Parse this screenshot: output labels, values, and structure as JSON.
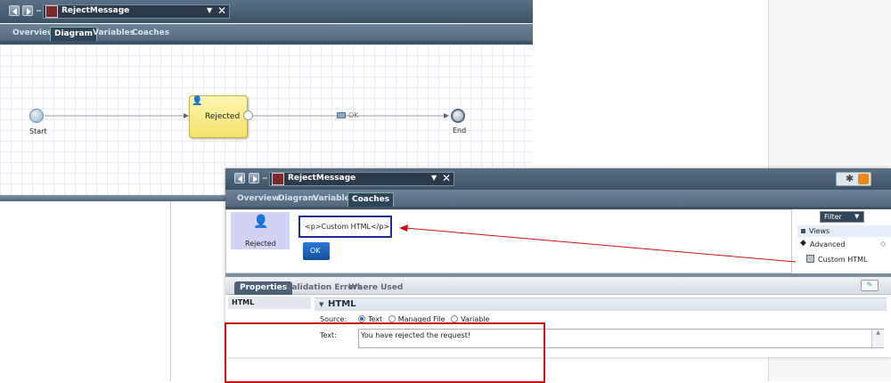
{
  "back_editor": {
    "title": "RejectMessage",
    "tabs": [
      "Overview",
      "Diagram",
      "Variables",
      "Coaches"
    ],
    "diagram": {
      "start_label": "Start",
      "coach_label": "Rejected",
      "flow_label": "OK",
      "end_label": "End"
    }
  },
  "front_editor": {
    "title": "RejectMessage",
    "tabs": [
      "Overview",
      "Diagram",
      "Variables",
      "Coaches"
    ],
    "coach_node": "Rejected",
    "custom_html_value": "<p>Custom HTML</p>",
    "ok_button": "OK",
    "palette": {
      "filter_label": "Filter",
      "items": [
        "Views",
        "Advanced",
        "Custom HTML"
      ]
    },
    "properties": {
      "tabs": [
        "Properties",
        "Validation Errors",
        "Where Used"
      ],
      "left_item": "HTML",
      "section_title": "HTML",
      "source_label": "Source:",
      "source_options": [
        "Text",
        "Managed File",
        "Variable"
      ],
      "text_label": "Text:",
      "text_value": "You have rejected the request!"
    }
  },
  "colors": {
    "annotation_red": "#cc1111",
    "selection_blue": "#1a2e9a",
    "coach_yellow": "#f7ea7a"
  }
}
